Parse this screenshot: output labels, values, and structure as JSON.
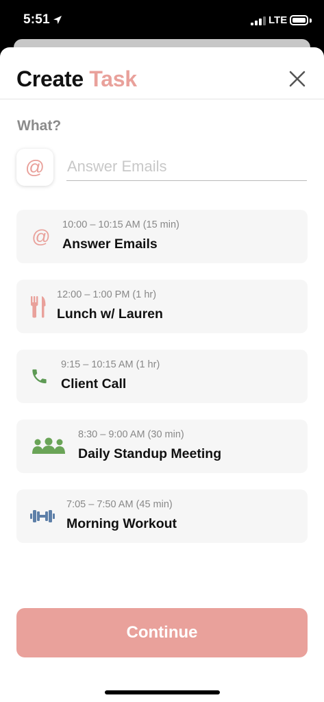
{
  "status_bar": {
    "time": "5:51",
    "network": "LTE"
  },
  "header": {
    "title_main": "Create",
    "title_accent": "Task"
  },
  "form": {
    "section_label": "What?",
    "task_name_placeholder": "Answer Emails",
    "selected_icon": "at-icon"
  },
  "suggestions": [
    {
      "icon": "at-icon",
      "time": "10:00 – 10:15 AM (15 min)",
      "title": "Answer Emails"
    },
    {
      "icon": "fork-knife-icon",
      "time": "12:00 – 1:00 PM (1 hr)",
      "title": "Lunch w/ Lauren"
    },
    {
      "icon": "phone-icon",
      "time": "9:15 – 10:15 AM (1 hr)",
      "title": "Client Call"
    },
    {
      "icon": "people-icon",
      "time": "8:30 – 9:00 AM (30 min)",
      "title": "Daily Standup Meeting"
    },
    {
      "icon": "dumbbell-icon",
      "time": "7:05 – 7:50 AM (45 min)",
      "title": "Morning Workout"
    }
  ],
  "continue_label": "Continue",
  "colors": {
    "accent": "#e9a19b",
    "phone_green": "#5e9a55",
    "people_green": "#6aa457",
    "dumbbell_blue": "#5d7fa8",
    "card_bg": "#f6f6f6"
  }
}
